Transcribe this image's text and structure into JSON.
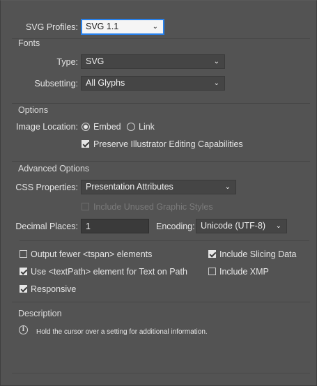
{
  "svg_profiles": {
    "label": "SVG Profiles:",
    "value": "SVG 1.1"
  },
  "fonts": {
    "title": "Fonts",
    "type": {
      "label": "Type:",
      "value": "SVG"
    },
    "subsetting": {
      "label": "Subsetting:",
      "value": "All Glyphs"
    }
  },
  "options": {
    "title": "Options",
    "image_location_label": "Image Location:",
    "embed_label": "Embed",
    "link_label": "Link",
    "selected": "Embed",
    "preserve_label": "Preserve Illustrator Editing Capabilities",
    "preserve_checked": true
  },
  "advanced": {
    "title": "Advanced Options",
    "css_label": "CSS Properties:",
    "css_value": "Presentation Attributes",
    "include_unused_label": "Include Unused Graphic Styles",
    "decimal_label": "Decimal Places:",
    "decimal_value": "1",
    "encoding_label": "Encoding:",
    "encoding_value": "Unicode (UTF-8)",
    "checks": {
      "fewer_tspan": {
        "label": "Output fewer <tspan> elements",
        "checked": false
      },
      "textpath": {
        "label": "Use <textPath> element for Text on Path",
        "checked": true
      },
      "responsive": {
        "label": "Responsive",
        "checked": true
      },
      "slicing": {
        "label": "Include Slicing Data",
        "checked": true
      },
      "xmp": {
        "label": "Include XMP",
        "checked": false
      }
    }
  },
  "description": {
    "title": "Description",
    "text": "Hold the cursor over a setting for additional information."
  },
  "icons": {
    "chevron": "chevron-down-icon",
    "info": "info-icon"
  },
  "colors": {
    "background": "#535353",
    "focus": "#2680eb"
  }
}
